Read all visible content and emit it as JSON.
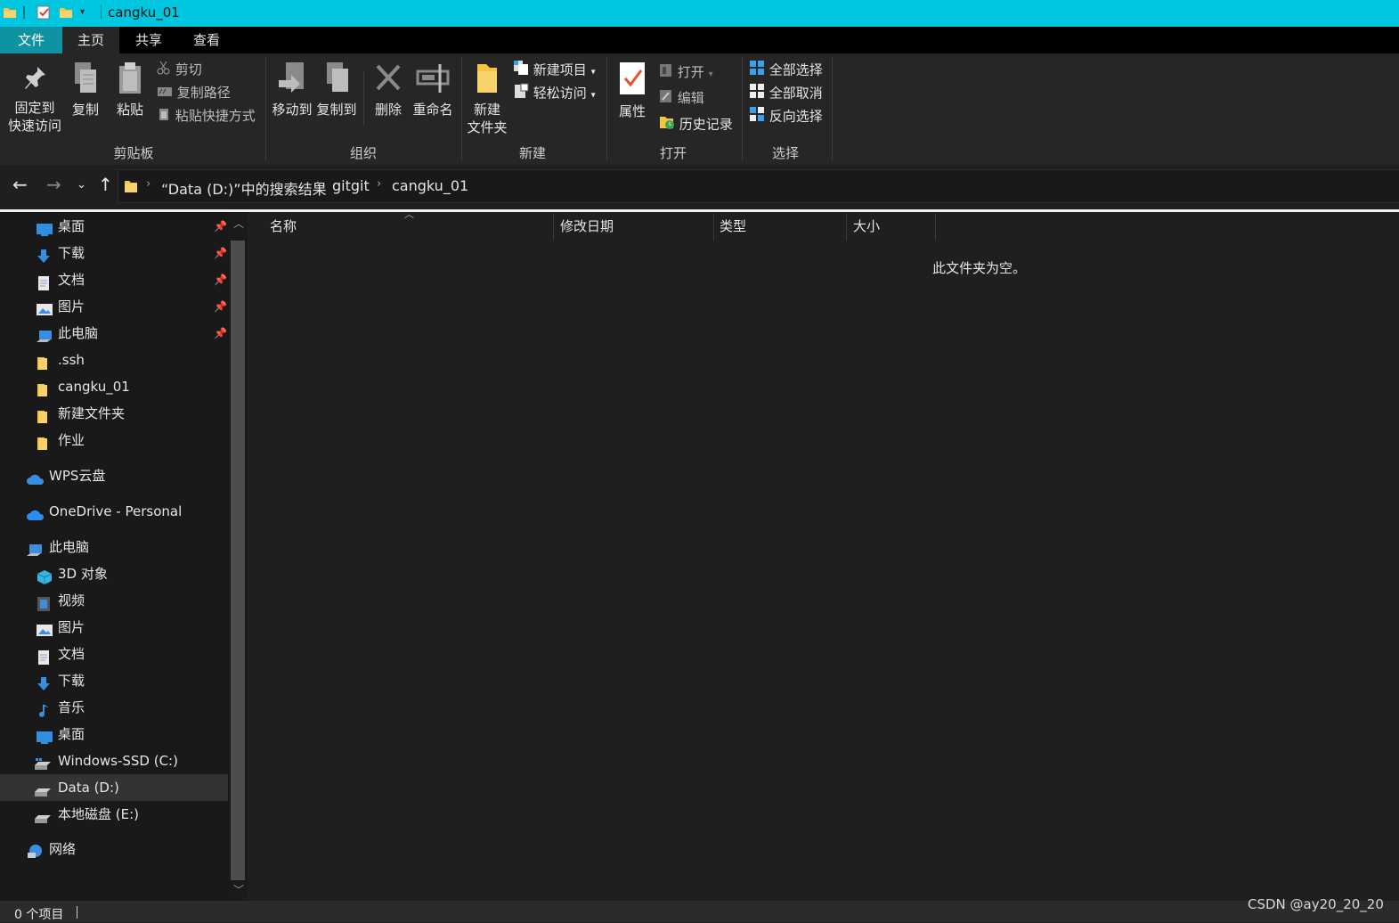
{
  "window": {
    "title": "cangku_01",
    "quick_access_icons": [
      "folder-icon",
      "properties-check-icon",
      "new-folder-icon",
      "customize-dropdown-icon"
    ]
  },
  "menu_tabs": [
    "文件",
    "主页",
    "共享",
    "查看"
  ],
  "ribbon": {
    "clipboard": {
      "group_label": "剪贴板",
      "pin_label_line1": "固定到",
      "pin_label_line2": "快速访问",
      "copy_label": "复制",
      "paste_label": "粘贴",
      "cut_label": "剪切",
      "copy_path_label": "复制路径",
      "paste_shortcut_label": "粘贴快捷方式"
    },
    "organize": {
      "group_label": "组织",
      "move_to_label": "移动到",
      "copy_to_label": "复制到",
      "delete_label": "删除",
      "rename_label": "重命名"
    },
    "new": {
      "group_label": "新建",
      "new_folder_line1": "新建",
      "new_folder_line2": "文件夹",
      "new_item_label": "新建项目",
      "easy_access_label": "轻松访问"
    },
    "open": {
      "group_label": "打开",
      "properties_label": "属性",
      "open_label": "打开",
      "edit_label": "编辑",
      "history_label": "历史记录"
    },
    "select": {
      "group_label": "选择",
      "select_all_label": "全部选择",
      "select_none_label": "全部取消",
      "invert_label": "反向选择"
    }
  },
  "address": {
    "breadcrumbs": [
      "“Data (D:)”中的搜索结果",
      "gitgit",
      "cangku_01"
    ]
  },
  "nav_pane": {
    "quick_access": [
      {
        "label": "桌面",
        "icon": "desktop-icon",
        "pinned": true
      },
      {
        "label": "下载",
        "icon": "download-icon",
        "pinned": true
      },
      {
        "label": "文档",
        "icon": "document-icon",
        "pinned": true
      },
      {
        "label": "图片",
        "icon": "picture-icon",
        "pinned": true
      },
      {
        "label": "此电脑",
        "icon": "computer-icon",
        "pinned": true
      },
      {
        "label": ".ssh",
        "icon": "folder-icon",
        "pinned": false
      },
      {
        "label": "cangku_01",
        "icon": "folder-icon",
        "pinned": false
      },
      {
        "label": "新建文件夹",
        "icon": "folder-icon",
        "pinned": false
      },
      {
        "label": "作业",
        "icon": "folder-icon",
        "pinned": false
      }
    ],
    "wps": "WPS云盘",
    "onedrive": "OneDrive - Personal",
    "this_pc": "此电脑",
    "pc_items": [
      {
        "label": "3D 对象",
        "icon": "3d-objects-icon"
      },
      {
        "label": "视频",
        "icon": "video-icon"
      },
      {
        "label": "图片",
        "icon": "picture-icon"
      },
      {
        "label": "文档",
        "icon": "document-icon"
      },
      {
        "label": "下载",
        "icon": "download-icon"
      },
      {
        "label": "音乐",
        "icon": "music-icon"
      },
      {
        "label": "桌面",
        "icon": "desktop-icon"
      },
      {
        "label": "Windows-SSD (C:)",
        "icon": "system-drive-icon"
      },
      {
        "label": "Data (D:)",
        "icon": "drive-icon",
        "selected": true
      },
      {
        "label": "本地磁盘 (E:)",
        "icon": "drive-icon"
      }
    ],
    "network": "网络"
  },
  "columns": [
    "名称",
    "修改日期",
    "类型",
    "大小"
  ],
  "empty_message": "此文件夹为空。",
  "status": {
    "item_count": "0 个项目",
    "watermark": "CSDN @ay20_20_20"
  },
  "colors": {
    "titlebar": "#00c7df",
    "file_tab": "#0f93a3",
    "background": "#1f1f1f",
    "folder_yellow": "#f5c443",
    "accent_blue": "#3aa0e8"
  }
}
